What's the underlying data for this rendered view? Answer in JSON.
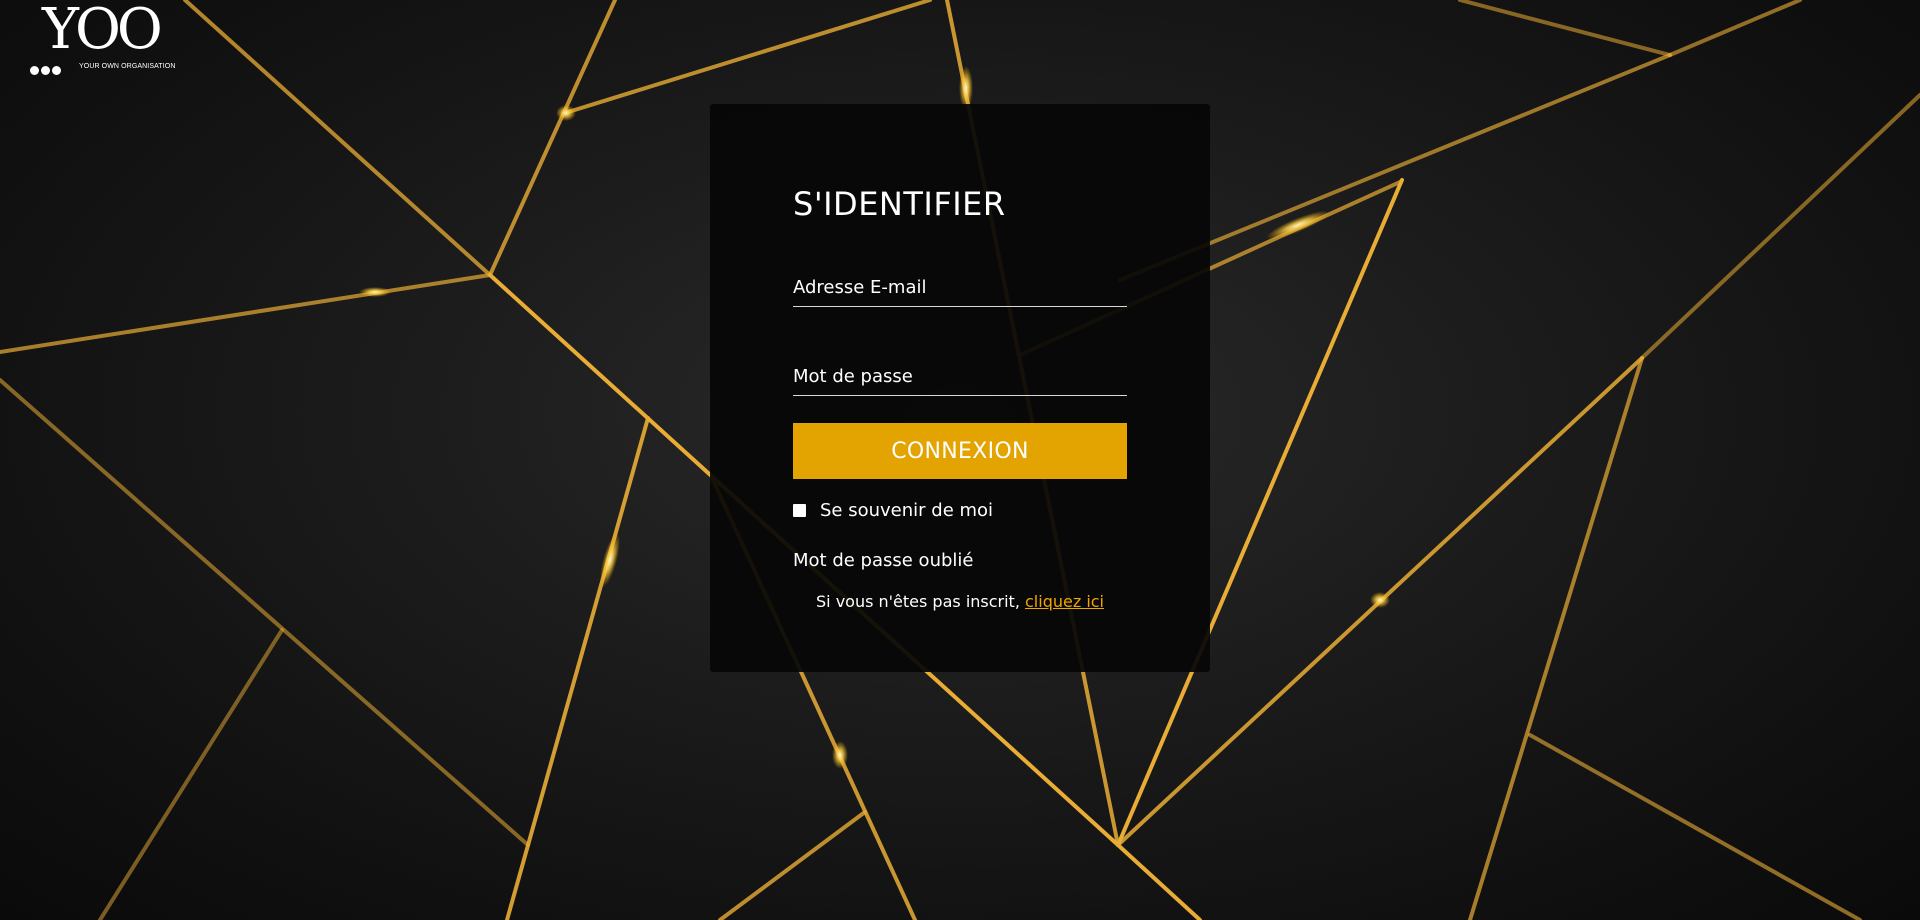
{
  "logo": {
    "mark": "YOO",
    "tagline": "YOUR OWN ORGANISATION"
  },
  "login": {
    "title": "S'IDENTIFIER",
    "email_placeholder": "Adresse E-mail",
    "password_placeholder": "Mot de passe",
    "submit_label": "CONNEXION",
    "remember_label": "Se souvenir de moi",
    "forgot_label": "Mot de passe oublié",
    "signup_text": "Si vous n'êtes pas inscrit, ",
    "signup_link": "cliquez ici"
  },
  "colors": {
    "accent": "#e3a300",
    "gold_line": "#f0b830",
    "background": "#141414",
    "link": "#f0a500"
  }
}
